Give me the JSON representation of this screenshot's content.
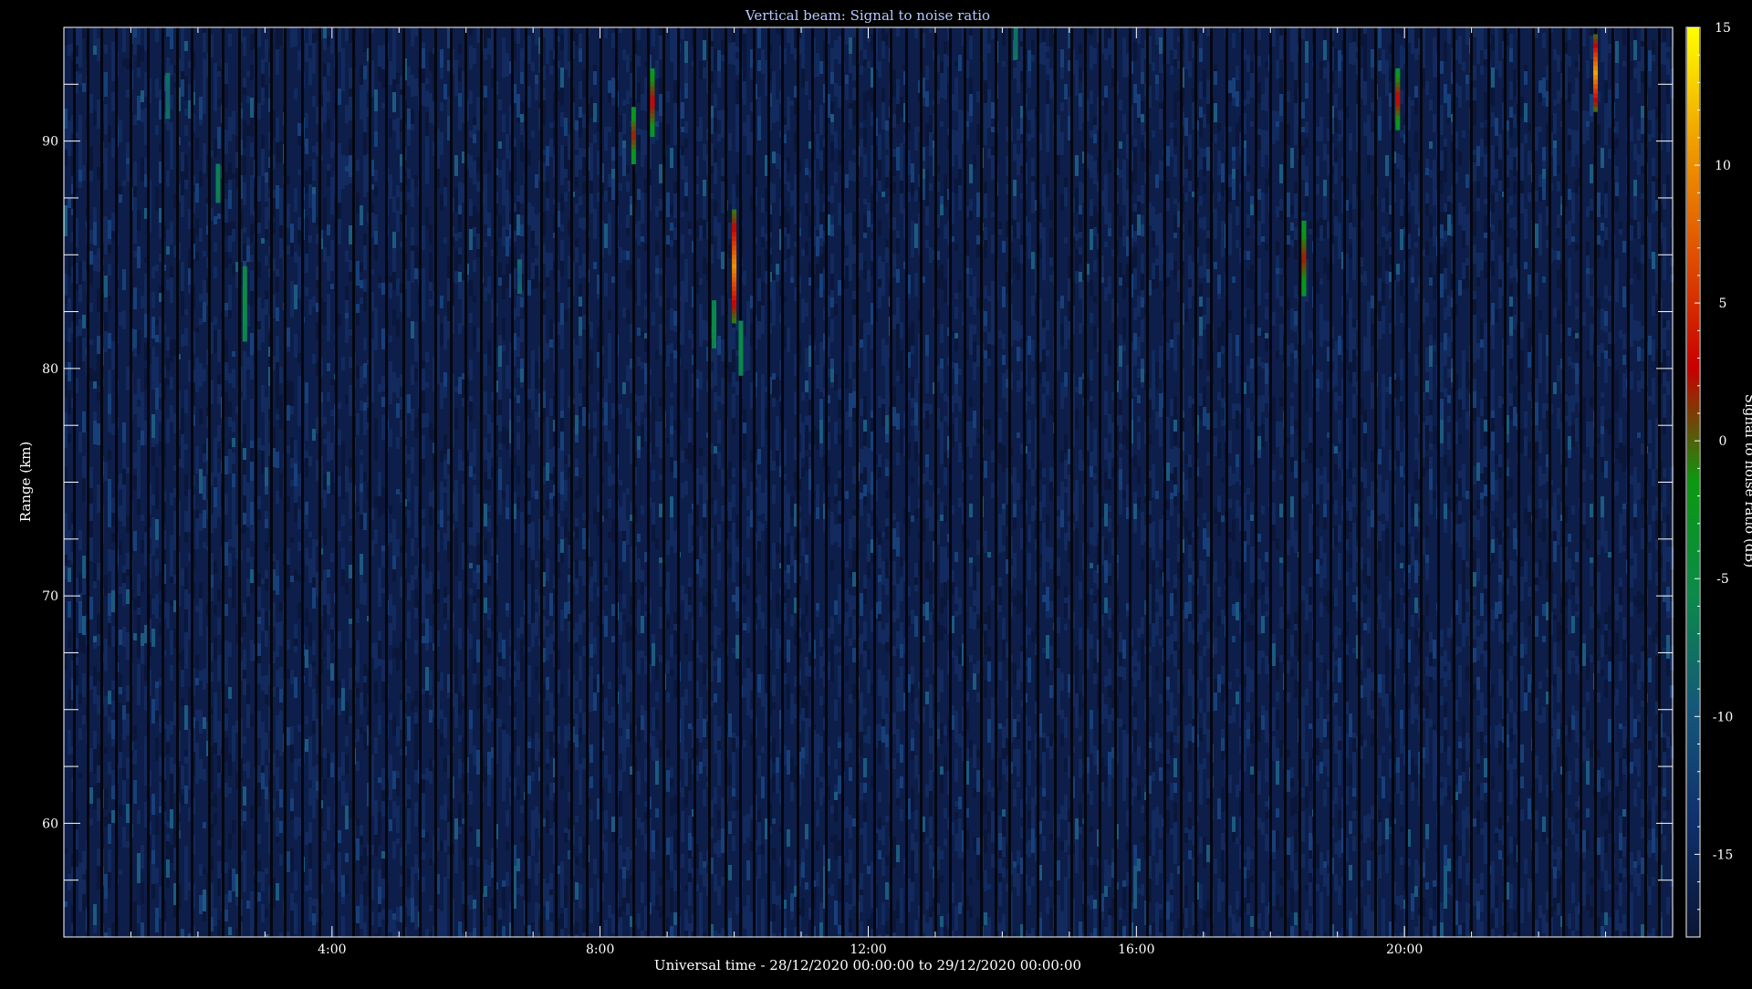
{
  "chart_data": {
    "type": "heatmap",
    "title": "Vertical beam: Signal to noise ratio",
    "xlabel": "Universal time - 28/12/2020 00:00:00 to 29/12/2020 00:00:00",
    "ylabel": "Range (km)",
    "xlim_hours": [
      0,
      24
    ],
    "ylim_km": [
      55,
      95
    ],
    "x_ticks": [
      {
        "hour": 4,
        "label": "4:00"
      },
      {
        "hour": 8,
        "label": "8:00"
      },
      {
        "hour": 12,
        "label": "12:00"
      },
      {
        "hour": 16,
        "label": "16:00"
      },
      {
        "hour": 20,
        "label": "20:00"
      }
    ],
    "y_ticks": [
      {
        "km": 60,
        "label": "60"
      },
      {
        "km": 70,
        "label": "70"
      },
      {
        "km": 80,
        "label": "80"
      },
      {
        "km": 90,
        "label": "90"
      }
    ],
    "colorbar": {
      "label": "Signal to noise ratio (dB)",
      "range_db": [
        -18,
        15
      ],
      "ticks": [
        {
          "db": 15,
          "label": "15"
        },
        {
          "db": 10,
          "label": "10"
        },
        {
          "db": 5,
          "label": "5"
        },
        {
          "db": 0,
          "label": "0"
        },
        {
          "db": -5,
          "label": "-5"
        },
        {
          "db": -10,
          "label": "-10"
        },
        {
          "db": -15,
          "label": "-15"
        }
      ],
      "colors": [
        "#0b1533",
        "#0f2f6b",
        "#15577a",
        "#0b8a4a",
        "#0a9a10",
        "#c80000",
        "#e05000",
        "#f0a000",
        "#ffff00"
      ]
    },
    "background_snr_db": -17,
    "grid": false,
    "echoes": [
      {
        "hour": 1.55,
        "range_km": [
          91.0,
          93.0
        ],
        "peak_db": -9
      },
      {
        "hour": 2.3,
        "range_km": [
          87.3,
          89.0
        ],
        "peak_db": -6
      },
      {
        "hour": 2.7,
        "range_km": [
          81.2,
          84.5
        ],
        "peak_db": -5
      },
      {
        "hour": 6.8,
        "range_km": [
          83.3,
          84.8
        ],
        "peak_db": -10
      },
      {
        "hour": 8.5,
        "range_km": [
          89.0,
          91.5
        ],
        "peak_db": 2
      },
      {
        "hour": 8.78,
        "range_km": [
          90.2,
          93.2
        ],
        "peak_db": 3
      },
      {
        "hour": 9.7,
        "range_km": [
          80.9,
          83.0
        ],
        "peak_db": -5
      },
      {
        "hour": 10.0,
        "range_km": [
          82.0,
          87.0
        ],
        "peak_db": 10
      },
      {
        "hour": 10.1,
        "range_km": [
          79.7,
          82.1
        ],
        "peak_db": -5
      },
      {
        "hour": 14.2,
        "range_km": [
          93.6,
          95.0
        ],
        "peak_db": -8
      },
      {
        "hour": 18.5,
        "range_km": [
          83.2,
          86.5
        ],
        "peak_db": 2
      },
      {
        "hour": 19.9,
        "range_km": [
          90.5,
          93.2
        ],
        "peak_db": 3
      },
      {
        "hour": 22.85,
        "range_km": [
          91.3,
          94.7
        ],
        "peak_db": 11
      }
    ]
  }
}
